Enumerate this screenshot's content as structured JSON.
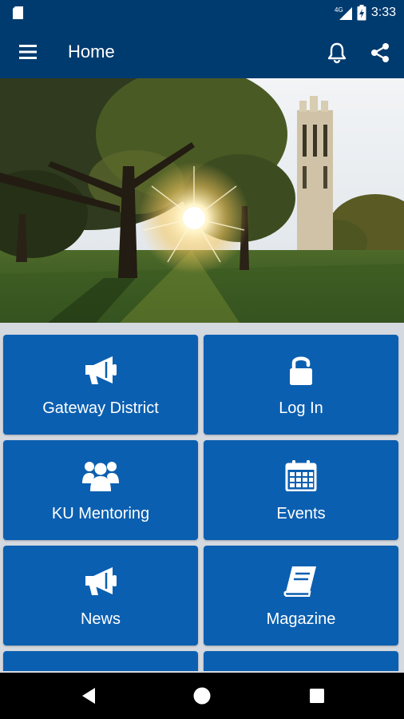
{
  "status_bar": {
    "network": "4G",
    "time": "3:33"
  },
  "app_bar": {
    "title": "Home"
  },
  "tiles": [
    {
      "label": "Gateway District",
      "icon": "megaphone-icon"
    },
    {
      "label": "Log In",
      "icon": "unlock-icon"
    },
    {
      "label": "KU Mentoring",
      "icon": "users-icon"
    },
    {
      "label": "Events",
      "icon": "calendar-icon"
    },
    {
      "label": "News",
      "icon": "megaphone-icon"
    },
    {
      "label": "Magazine",
      "icon": "book-icon"
    }
  ],
  "colors": {
    "header": "#003b6f",
    "tile": "#0b5fb0",
    "background": "#d4d9e0"
  }
}
